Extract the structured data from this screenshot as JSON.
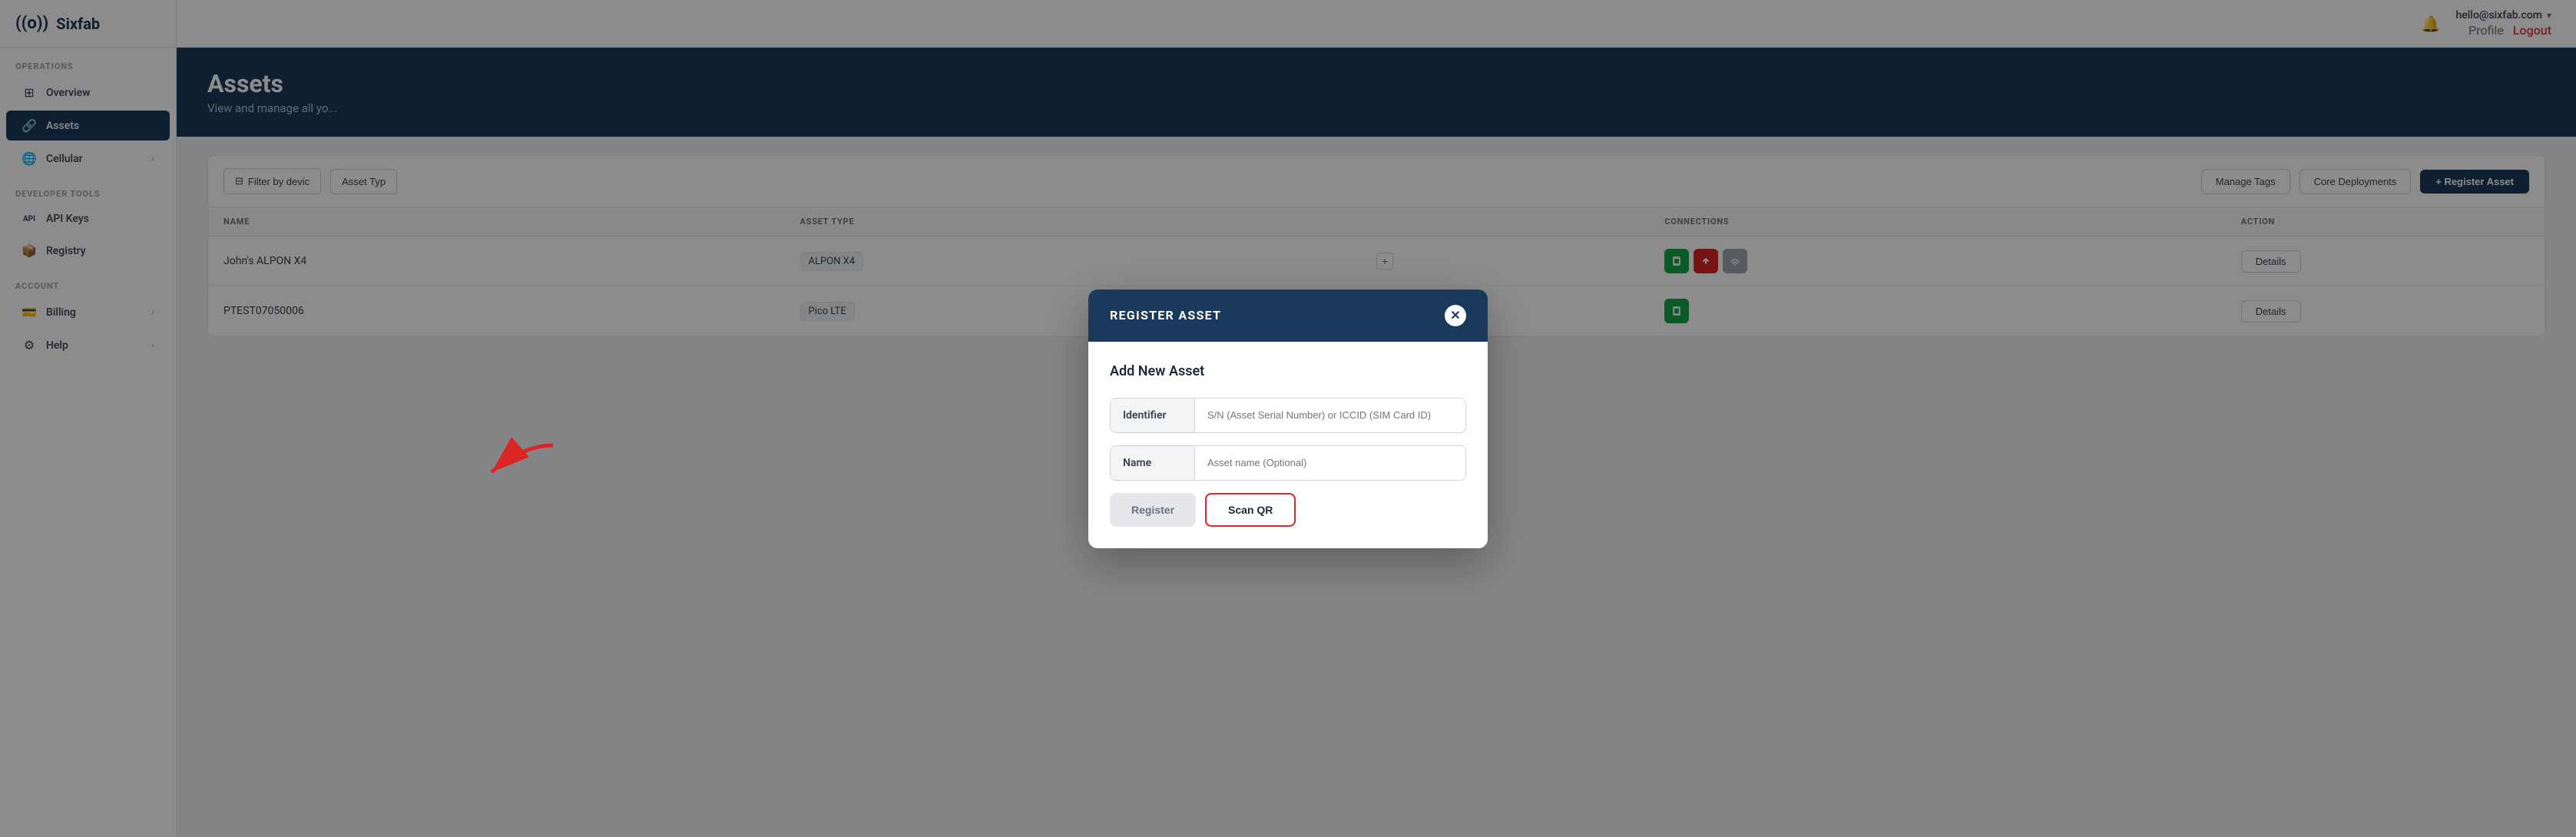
{
  "app": {
    "logo_symbol": "((o))",
    "logo_name": "Sixfab"
  },
  "sidebar": {
    "back_icon": "←",
    "sections": [
      {
        "label": "Operations",
        "items": [
          {
            "id": "overview",
            "icon": "⊞",
            "label": "Overview",
            "active": false,
            "chevron": false
          },
          {
            "id": "assets",
            "icon": "🔗",
            "label": "Assets",
            "active": true,
            "chevron": false
          },
          {
            "id": "cellular",
            "icon": "🌐",
            "label": "Cellular",
            "active": false,
            "chevron": true
          }
        ]
      },
      {
        "label": "Developer Tools",
        "items": [
          {
            "id": "api-keys",
            "icon": "API",
            "label": "API Keys",
            "active": false,
            "chevron": false
          },
          {
            "id": "registry",
            "icon": "📦",
            "label": "Registry",
            "active": false,
            "chevron": false
          }
        ]
      },
      {
        "label": "Account",
        "items": [
          {
            "id": "billing",
            "icon": "💳",
            "label": "Billing",
            "active": false,
            "chevron": true
          },
          {
            "id": "help",
            "icon": "⚙",
            "label": "Help",
            "active": false,
            "chevron": true
          }
        ]
      }
    ]
  },
  "header": {
    "bell_icon": "🔔",
    "user_email": "hello@sixfab.com",
    "chevron": "▾",
    "profile_label": "Profile",
    "logout_label": "Logout"
  },
  "page": {
    "title": "Assets",
    "subtitle": "View and manage all yo..."
  },
  "toolbar": {
    "filter_icon": "⊟",
    "filter_label": "Filter by devic",
    "asset_type_label": "Asset Typ",
    "manage_tags_label": "Manage Tags",
    "core_deployments_label": "Core Deployments",
    "register_asset_label": "+ Register Asset"
  },
  "table": {
    "columns": [
      "NAME",
      "ASSET TYPE",
      "",
      "CONNECTIONS",
      "ACTION"
    ],
    "rows": [
      {
        "name": "John's ALPON X4",
        "asset_type": "ALPON X4",
        "connections": [
          "sim-green",
          "upload-red",
          "signal-gray"
        ],
        "action": "Details"
      },
      {
        "name": "PTEST07050006",
        "asset_type": "Pico LTE",
        "connections": [
          "sim-green"
        ],
        "action": "Details"
      }
    ]
  },
  "modal": {
    "title": "REGISTER ASSET",
    "close_icon": "✕",
    "subtitle": "Add New Asset",
    "identifier_label": "Identifier",
    "identifier_placeholder": "S/N (Asset Serial Number) or ICCID (SIM Card ID)",
    "name_label": "Name",
    "name_placeholder": "Asset name (Optional)",
    "register_btn_label": "Register",
    "scan_qr_btn_label": "Scan QR"
  }
}
